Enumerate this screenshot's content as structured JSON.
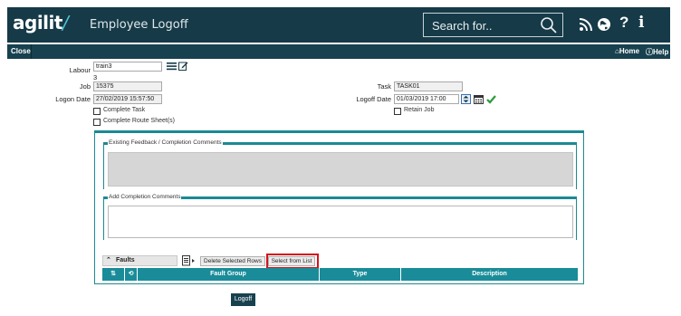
{
  "header": {
    "logo": "agilit",
    "logo_slash": "/",
    "title": "Employee Logoff",
    "search_placeholder": "Search for.."
  },
  "toolbar": {
    "close": "Close",
    "home": "Home",
    "help": "Help"
  },
  "form": {
    "labour_label": "Labour",
    "labour_value": "train3",
    "labour_sub": "3",
    "job_label": "Job",
    "job_value": "15375",
    "logon_date_label": "Logon Date",
    "logon_date_value": "27/02/2019 15:57:50",
    "task_label": "Task",
    "task_value": "TASK01",
    "logoff_date_label": "Logoff Date",
    "logoff_date_value": "01/03/2019 17:00",
    "complete_task": "Complete Task",
    "complete_route": "Complete Route Sheet(s)",
    "retain_job": "Retain Job"
  },
  "feedback": {
    "existing_title": "Existing Feedback / Completion Comments",
    "add_title": "Add Completion Comments"
  },
  "faults": {
    "title": "Faults",
    "delete_rows": "Delete Selected Rows",
    "select_from_list": "Select from List",
    "columns": [
      "Fault Group",
      "Type",
      "Description"
    ]
  },
  "actions": {
    "logoff": "Logoff"
  },
  "colors": {
    "header_bg": "#163a47",
    "accent": "#1a8c99",
    "highlight_border": "#d0141c"
  }
}
